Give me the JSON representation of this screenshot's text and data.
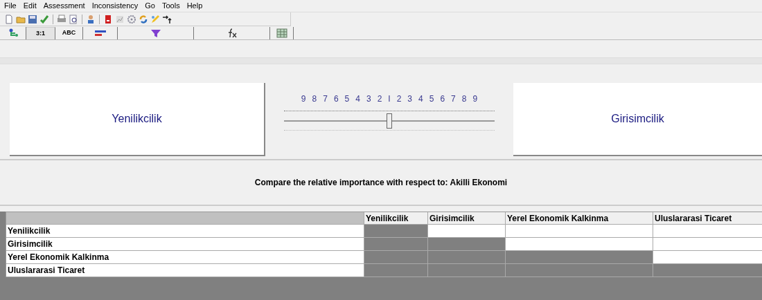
{
  "menu": [
    "File",
    "Edit",
    "Assessment",
    "Inconsistency",
    "Go",
    "Tools",
    "Help"
  ],
  "toolbar": [
    {
      "kind": "page"
    },
    {
      "kind": "folder"
    },
    {
      "kind": "disk"
    },
    {
      "kind": "check"
    },
    {
      "kind": "sep"
    },
    {
      "kind": "printer"
    },
    {
      "kind": "preview"
    },
    {
      "kind": "sep"
    },
    {
      "kind": "person"
    },
    {
      "kind": "sep"
    },
    {
      "kind": "book"
    },
    {
      "kind": "chart"
    },
    {
      "kind": "gear"
    },
    {
      "kind": "cycle"
    },
    {
      "kind": "pen"
    },
    {
      "kind": "arrows"
    }
  ],
  "tabs": [
    {
      "kind": "tree",
      "selected": false
    },
    {
      "kind": "text",
      "label": "3:1",
      "selected": true
    },
    {
      "kind": "text",
      "label": "ABC",
      "selected": false
    },
    {
      "kind": "bars",
      "selected": false
    },
    {
      "kind": "funnel",
      "selected": false
    },
    {
      "kind": "formula",
      "selected": false
    },
    {
      "kind": "grid",
      "selected": false
    }
  ],
  "comparison": {
    "left": "Yenilikcilik",
    "right": "Girisimcilik",
    "scale": [
      "9",
      "8",
      "7",
      "6",
      "5",
      "4",
      "3",
      "2",
      "I",
      "2",
      "3",
      "4",
      "5",
      "6",
      "7",
      "8",
      "9"
    ],
    "level": 0.5
  },
  "caption": "Compare the relative importance with respect to: Akilli Ekonomi",
  "table": {
    "columns": [
      "Yenilikcilik",
      "Girisimcilik",
      "Yerel Ekonomik Kalkinma",
      "Uluslararasi Ticaret"
    ],
    "rows": [
      {
        "label": "Yenilikcilik",
        "cells": [
          {
            "shaded": true
          },
          {
            "shaded": false
          },
          {
            "shaded": false
          },
          {
            "shaded": false
          }
        ]
      },
      {
        "label": "Girisimcilik",
        "cells": [
          {
            "shaded": true
          },
          {
            "shaded": true
          },
          {
            "shaded": false
          },
          {
            "shaded": false
          }
        ]
      },
      {
        "label": "Yerel Ekonomik Kalkinma",
        "cells": [
          {
            "shaded": true
          },
          {
            "shaded": true
          },
          {
            "shaded": true
          },
          {
            "shaded": false
          }
        ]
      },
      {
        "label": "Uluslararasi Ticaret",
        "cells": [
          {
            "shaded": true
          },
          {
            "shaded": true
          },
          {
            "shaded": true
          },
          {
            "shaded": true
          }
        ]
      }
    ]
  }
}
